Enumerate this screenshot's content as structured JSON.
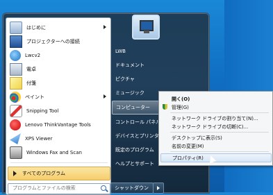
{
  "left_items": [
    {
      "label": "はじめに",
      "icon": "getting-started-icon",
      "has_arrow": true
    },
    {
      "label": "プロジェクターへの接続",
      "icon": "projector-icon",
      "has_arrow": false
    },
    {
      "label": "Lwcv2",
      "icon": "lwcv2-icon",
      "has_arrow": false
    },
    {
      "label": "電卓",
      "icon": "calculator-icon",
      "has_arrow": false
    },
    {
      "label": "付箋",
      "icon": "sticky-notes-icon",
      "has_arrow": false
    },
    {
      "label": "ペイント",
      "icon": "paint-icon",
      "has_arrow": true
    },
    {
      "label": "Snipping Tool",
      "icon": "snipping-tool-icon",
      "has_arrow": false
    },
    {
      "label": "Lenovo ThinkVantage Tools",
      "icon": "thinkvantage-icon",
      "has_arrow": false
    },
    {
      "label": "XPS Viewer",
      "icon": "xps-viewer-icon",
      "has_arrow": false
    },
    {
      "label": "Windows Fax and Scan",
      "icon": "fax-scan-icon",
      "has_arrow": false
    }
  ],
  "all_programs": "すべてのプログラム",
  "search_placeholder": "プログラムとファイルの検索",
  "right_items": [
    {
      "label": "LWB"
    },
    {
      "label": "ドキュメント"
    },
    {
      "label": "ピクチャ"
    },
    {
      "label": "ミュージック"
    },
    {
      "label": "コンピューター"
    },
    {
      "label": "コントロール パネル"
    },
    {
      "label": "デバイスとプリンター"
    },
    {
      "label": "既定のプログラム"
    },
    {
      "label": "ヘルプとサポート"
    }
  ],
  "shutdown_label": "シャットダウン",
  "context_menu": [
    {
      "label": "開く(O)",
      "bold": true
    },
    {
      "label": "管理(G)",
      "shield": true
    },
    {
      "label": "ネットワーク ドライブの割り当て(N)..."
    },
    {
      "label": "ネットワーク ドライブの切断(C)..."
    },
    {
      "label": "デスクトップに表示(S)"
    },
    {
      "label": "名前の変更(M)"
    },
    {
      "label": "プロパティ(R)",
      "highlighted": true
    }
  ]
}
